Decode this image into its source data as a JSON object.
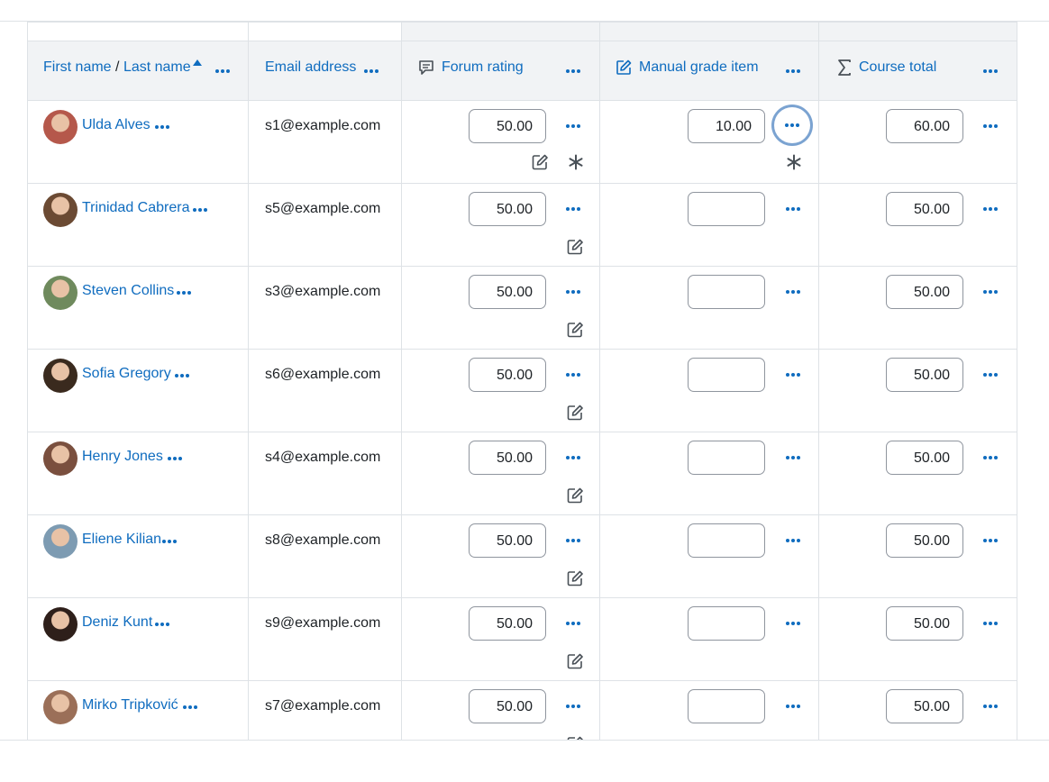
{
  "columns": {
    "name": {
      "first": "First name",
      "separator": "/",
      "last": "Last name"
    },
    "email": "Email address",
    "forum": "Forum rating",
    "manual": "Manual grade item",
    "total": "Course total"
  },
  "rows": [
    {
      "name": "Ulda Alves",
      "email": "s1@example.com",
      "forum": "50.00",
      "manual": "10.00",
      "total": "60.00",
      "avatar_color": "#b5584b"
    },
    {
      "name": "Trinidad Cabrera",
      "email": "s5@example.com",
      "forum": "50.00",
      "manual": "",
      "total": "50.00",
      "avatar_color": "#6b4a33"
    },
    {
      "name": "Steven Collins",
      "email": "s3@example.com",
      "forum": "50.00",
      "manual": "",
      "total": "50.00",
      "avatar_color": "#6f8a5d"
    },
    {
      "name": "Sofia Gregory",
      "email": "s6@example.com",
      "forum": "50.00",
      "manual": "",
      "total": "50.00",
      "avatar_color": "#3a2a1e"
    },
    {
      "name": "Henry Jones",
      "email": "s4@example.com",
      "forum": "50.00",
      "manual": "",
      "total": "50.00",
      "avatar_color": "#7a4f3e"
    },
    {
      "name": "Eliene Kilian",
      "email": "s8@example.com",
      "forum": "50.00",
      "manual": "",
      "total": "50.00",
      "avatar_color": "#7d9bb2"
    },
    {
      "name": "Deniz Kunt",
      "email": "s9@example.com",
      "forum": "50.00",
      "manual": "",
      "total": "50.00",
      "avatar_color": "#2e1f1a"
    },
    {
      "name": "Mirko Tripković",
      "email": "s7@example.com",
      "forum": "50.00",
      "manual": "",
      "total": "50.00",
      "avatar_color": "#9b6f58"
    }
  ],
  "colors": {
    "link": "#0f6cbf",
    "header_bg": "#f1f3f5",
    "border": "#dee2e6",
    "focus_ring": "#7ba3d1"
  }
}
